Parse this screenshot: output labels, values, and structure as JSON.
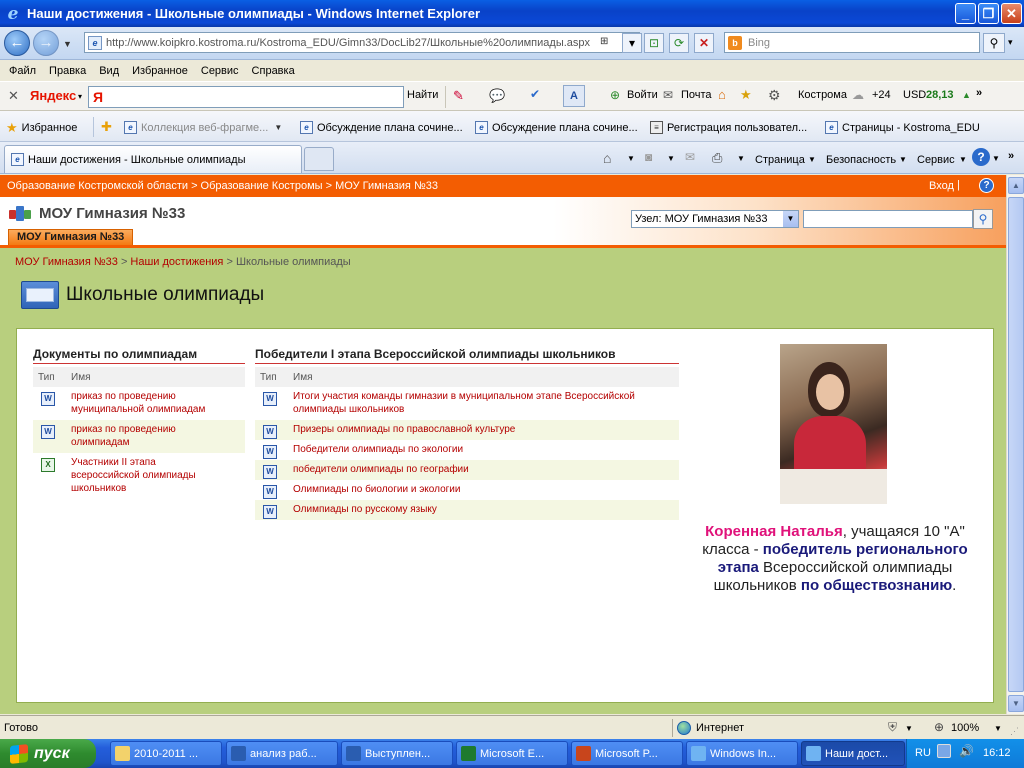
{
  "window": {
    "title": "Наши достижения - Школьные олимпиады - Windows Internet Explorer"
  },
  "nav": {
    "url": "http://www.koipkro.kostroma.ru/Kostroma_EDU/Gimn33/DocLib27/Школьные%20олимпиады.aspx",
    "search_placeholder": "Bing"
  },
  "menu": [
    "Файл",
    "Правка",
    "Вид",
    "Избранное",
    "Сервис",
    "Справка"
  ],
  "yandex": {
    "logo": "Яндекс",
    "find": "Найти",
    "login": "Войти",
    "mail": "Почта",
    "city": "Кострома",
    "temp": "+24",
    "usd_label": "USD",
    "usd_value": "28,13"
  },
  "favorites": {
    "label": "Избранное",
    "items": [
      "Коллекция веб-фрагме...",
      "Обсуждение плана сочине...",
      "Обсуждение плана сочине...",
      "Регистрация пользовател...",
      "Страницы - Kostroma_EDU"
    ]
  },
  "tab": {
    "active_label": "Наши достижения - Школьные олимпиады"
  },
  "commands": {
    "page": "Страница",
    "safety": "Безопасность",
    "tools": "Сервис"
  },
  "site": {
    "breadcrumb_top": [
      "Образование Костромской области",
      "Образование Костромы",
      "МОУ Гимназия №33"
    ],
    "login": "Вход",
    "title": "МОУ Гимназия №33",
    "node_select": "Узел: МОУ Гимназия №33",
    "tab": "МОУ Гимназия №33",
    "page_breadcrumb": [
      "МОУ Гимназия №33",
      "Наши достижения",
      "Школьные олимпиады"
    ],
    "page_title": "Школьные олимпиады"
  },
  "list_docs": {
    "title": "Документы по олимпиадам",
    "col_type": "Тип",
    "col_name": "Имя",
    "items": [
      {
        "name": "приказ по проведению муниципальной олимпиадам",
        "icon": "word-doc-icon"
      },
      {
        "name": "приказ по проведению олимпиадам",
        "icon": "word-doc-icon"
      },
      {
        "name": "Участники II этапа всероссийской олимпиады школьников",
        "icon": "excel-doc-icon"
      }
    ]
  },
  "list_winners": {
    "title": "Победители I этапа Всероссийской олимпиады школьников",
    "col_type": "Тип",
    "col_name": "Имя",
    "items": [
      {
        "name": "Итоги участия команды гимназии в муниципальном этапе Всероссийской олимпиады школьников",
        "icon": "word-doc-icon"
      },
      {
        "name": "Призеры олимпиады по православной культуре",
        "icon": "word-doc-icon"
      },
      {
        "name": "Победители олимпиады по экологии",
        "icon": "word-doc-icon"
      },
      {
        "name": "победители олимпиады по географии",
        "icon": "word-doc-icon"
      },
      {
        "name": "Олимпиады по биологии и экологии",
        "icon": "word-doc-icon"
      },
      {
        "name": "Олимпиады по русскому языку",
        "icon": "word-doc-icon"
      }
    ]
  },
  "winner": {
    "name": "Коренная Наталья",
    "text1": ", учащаяся 10 \"А\" класса - ",
    "highlight1": "победитель регионального этапа",
    "text2": " Всероссийской олимпиады школьников ",
    "highlight2": "по обществознанию",
    "text3": "."
  },
  "status": {
    "text": "Готово",
    "zone": "Интернет",
    "zoom": "100%"
  },
  "taskbar": {
    "start": "пуск",
    "tasks": [
      "2010-2011 ...",
      "анализ раб...",
      "Выступлен...",
      "Microsoft E...",
      "Microsoft P...",
      "Windows In...",
      "Наши дост..."
    ],
    "lang": "RU",
    "clock": "16:12"
  },
  "colors": {
    "accent_orange": "#f35d02",
    "link_red": "#b40000",
    "body_green": "#b8cf7e",
    "highlight_navy": "#1a1a7a",
    "name_pink": "#e0127a"
  }
}
